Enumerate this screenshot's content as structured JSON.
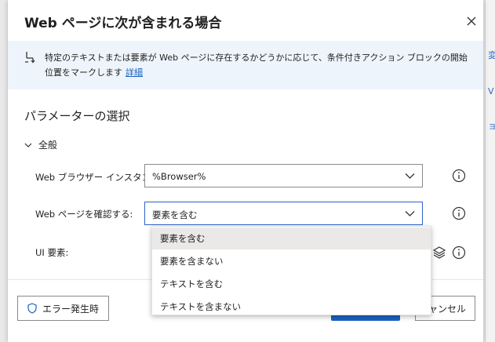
{
  "dialog": {
    "title": "Web ページに次が含まれる場合",
    "info_text": "特定のテキストまたは要素が Web ページに存在するかどうかに応じて、条件付きアクション ブロックの開始位置をマークします",
    "info_link": "詳細",
    "section_title": "パラメーターの選択",
    "group_label": "全般"
  },
  "fields": {
    "browser_instance": {
      "label": "Web ブラウザー インスタンス:",
      "value": "%Browser%"
    },
    "check_page": {
      "label": "Web ページを確認する:",
      "value": "要素を含む"
    },
    "ui_element": {
      "label": "UI 要素:"
    }
  },
  "dropdown": {
    "options": [
      "要素を含む",
      "要素を含まない",
      "テキストを含む",
      "テキストを含まない"
    ],
    "selected_index": 0
  },
  "footer": {
    "error_button": "エラー発生時",
    "cancel_button": "キャンセル"
  },
  "background": {
    "fragments": [
      "変",
      "V",
      "ョ"
    ]
  },
  "colors": {
    "accent": "#1a62c4",
    "banner_bg": "#eef4fb",
    "selected_option_bg": "#ebe9e7"
  }
}
